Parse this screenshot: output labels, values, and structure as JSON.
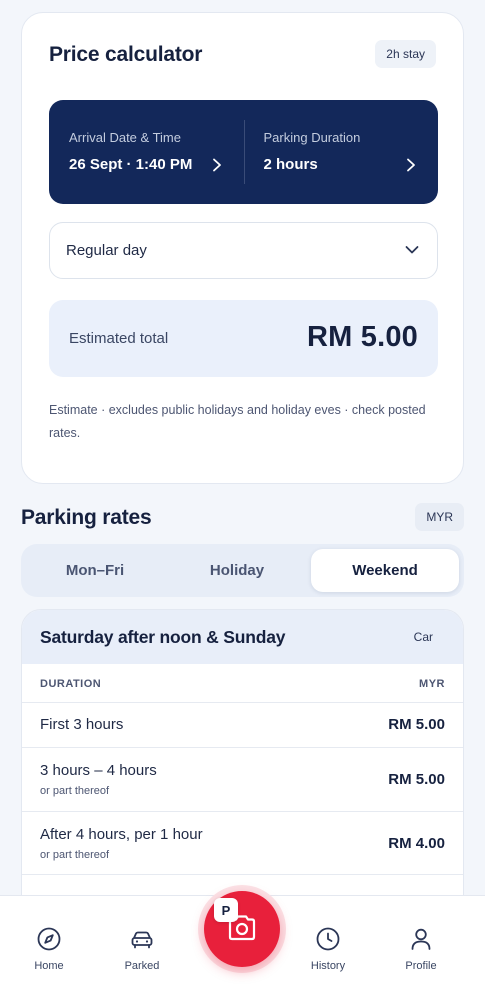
{
  "calculator": {
    "title": "Price calculator",
    "stay_badge": "2h stay",
    "arrival_label": "Arrival Date & Time",
    "arrival_value": "26 Sept · 1:40 PM",
    "duration_label": "Parking Duration",
    "duration_value": "2 hours",
    "day_type_selected": "Regular day",
    "estimate_label": "Estimated total",
    "estimate_value": "RM 5.00",
    "disclaimer": "Estimate · excludes public holidays and holiday eves · check posted rates."
  },
  "rates": {
    "title": "Parking rates",
    "currency_badge": "MYR",
    "tabs": [
      {
        "label": "Mon–Fri",
        "active": false
      },
      {
        "label": "Holiday",
        "active": false
      },
      {
        "label": "Weekend",
        "active": true
      }
    ],
    "card_title": "Saturday after noon & Sunday",
    "vehicle": "Car",
    "col_duration": "DURATION",
    "col_currency": "MYR",
    "rows": [
      {
        "label": "First 3 hours",
        "sub": "",
        "price": "RM 5.00"
      },
      {
        "label": "3 hours – 4 hours",
        "sub": "or part thereof",
        "price": "RM 5.00"
      },
      {
        "label": "After 4 hours, per 1 hour",
        "sub": "or part thereof",
        "price": "RM 4.00"
      }
    ]
  },
  "nav": {
    "items": [
      {
        "label": "Home",
        "icon": "compass-icon"
      },
      {
        "label": "Parked",
        "icon": "car-icon"
      },
      {
        "label": "History",
        "icon": "clock-icon"
      },
      {
        "label": "Profile",
        "icon": "user-icon"
      }
    ],
    "fab_badge": "P",
    "fab_icon": "camera-icon"
  },
  "colors": {
    "primary_dark": "#13285a",
    "accent_red": "#e8203b",
    "estimate_bg": "#eaf0fb"
  }
}
